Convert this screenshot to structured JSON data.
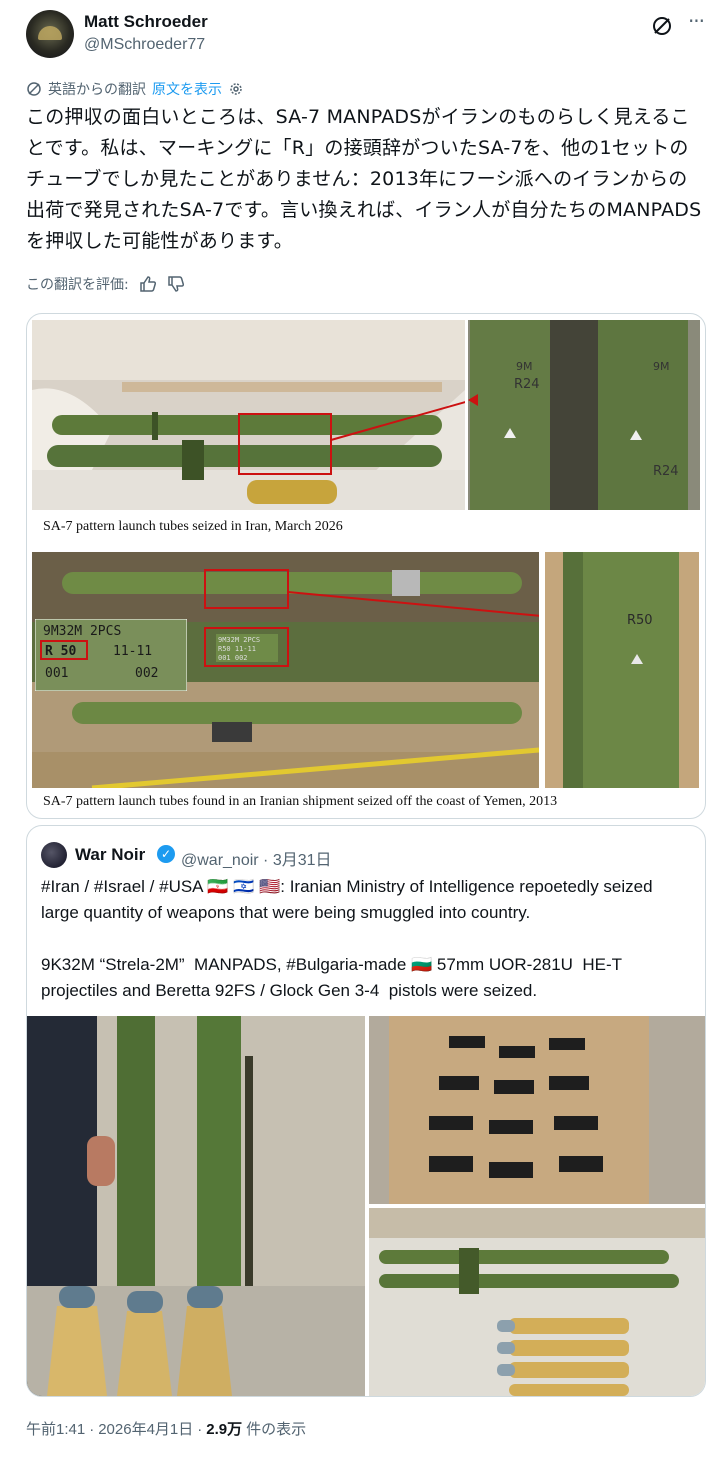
{
  "author": {
    "name": "Matt Schroeder",
    "handle": "@MSchroeder77"
  },
  "translation": {
    "notice": "英語からの翻訳",
    "show_original": "原文を表示"
  },
  "post_text": "この押収の面白いところは、SA-7 MANPADSがイランのものらしく見えることです。私は、マーキングに「R」の接頭辞がついたSA-7を、他の1セットのチューブでしか見たことがありません：2013年にフーシ派へのイランからの出荷で発見されたSA-7です。言い換えれば、イラン人が自分たちのMANPADSを押収した可能性があります。",
  "rate": {
    "label": "この翻訳を評価:"
  },
  "media": {
    "caption_top": "SA-7 pattern launch tubes seized in Iran, March 2026",
    "caption_bottom": "SA-7 pattern launch tubes found in an Iranian shipment seized off the coast of Yemen, 2013",
    "top_right_labels": [
      "9M",
      "R24",
      "9M",
      "R24"
    ],
    "inset": {
      "line1": "9M32M  2PCS",
      "r50": "R 50",
      "date": "11-11",
      "n1": "001",
      "n2": "002"
    },
    "bottom_right_label": "R50",
    "crate_text": [
      "9M32M 2PCS",
      "R50  11-11",
      "001    002"
    ]
  },
  "quote": {
    "name": "War Noir",
    "handle": "@war_noir",
    "date": "3月31日",
    "text_1": "#Iran / #Israel / #USA 🇮🇷 🇮🇱 🇺🇸: Iranian Ministry of Intelligence repoetedly seized large quantity of weapons that were being smuggled into country.",
    "text_2": "9K32M “Strela-2M”  MANPADS, #Bulgaria-made 🇧🇬 57mm UOR-281U  HE-T projectiles and Beretta 92FS / Glock Gen 3-4  pistols were seized."
  },
  "footer": {
    "time": "午前1:41",
    "date": "2026年4月1日",
    "views": "2.9万",
    "views_label": "件の表示"
  },
  "colors": {
    "accent": "#1d9bf0",
    "secondary_text": "#536471",
    "border": "#cfd9de",
    "tube_green": "#5d7a3a"
  }
}
